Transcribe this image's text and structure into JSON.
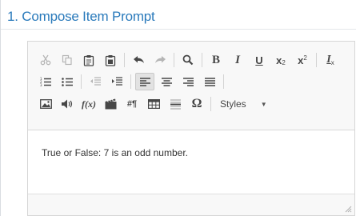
{
  "header": {
    "title": "1. Compose Item Prompt"
  },
  "toolbar": {
    "row1": [
      {
        "name": "cut-icon",
        "glyph": "✂",
        "dim": true
      },
      {
        "name": "copy-icon",
        "glyph": "⎘",
        "dim": true
      },
      {
        "name": "paste-icon",
        "glyph": "📋",
        "dim": false
      },
      {
        "name": "paste-text-icon",
        "glyph": "📋",
        "dim": false
      },
      {
        "name": "undo-icon",
        "glyph": "↶",
        "dim": false
      },
      {
        "name": "redo-icon",
        "glyph": "↷",
        "dim": true
      },
      {
        "name": "find-icon",
        "glyph": "🔍",
        "dim": false
      },
      {
        "name": "bold-icon",
        "glyph": "B"
      },
      {
        "name": "italic-icon",
        "glyph": "I"
      },
      {
        "name": "underline-icon",
        "glyph": "U"
      },
      {
        "name": "subscript-icon",
        "glyph": "x₂"
      },
      {
        "name": "superscript-icon",
        "glyph": "x²"
      },
      {
        "name": "remove-format-icon",
        "glyph": "Ix"
      }
    ],
    "styles_label": "Styles"
  },
  "editor": {
    "content": "True or False: 7 is an odd number."
  }
}
